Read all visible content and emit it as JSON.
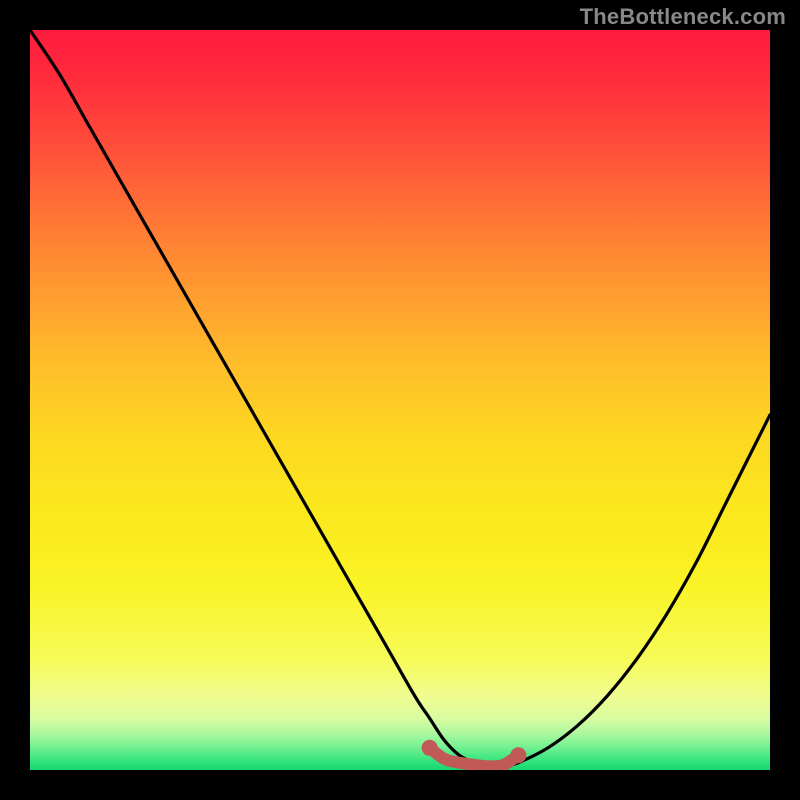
{
  "attribution": "TheBottleneck.com",
  "colors": {
    "background": "#000000",
    "curve": "#000000",
    "marker": "#c15a56",
    "gradient_top": "#ff1a3e",
    "gradient_bottom": "#17d56e"
  },
  "chart_data": {
    "type": "line",
    "title": "",
    "xlabel": "",
    "ylabel": "",
    "xlim": [
      0,
      100
    ],
    "ylim": [
      0,
      100
    ],
    "series": [
      {
        "name": "bottleneck-curve",
        "x": [
          0,
          4,
          8,
          12,
          16,
          20,
          24,
          28,
          32,
          36,
          40,
          44,
          48,
          52,
          54,
          56,
          58,
          60,
          62,
          64,
          66,
          70,
          74,
          78,
          82,
          86,
          90,
          94,
          98,
          100
        ],
        "y": [
          100,
          94,
          87,
          80,
          73,
          66,
          59,
          52,
          45,
          38,
          31,
          24,
          17,
          10,
          7,
          4,
          2,
          1,
          0.5,
          0.5,
          1,
          3,
          6,
          10,
          15,
          21,
          28,
          36,
          44,
          48
        ]
      },
      {
        "name": "highlight-band",
        "x": [
          54,
          56,
          58,
          60,
          62,
          64,
          66
        ],
        "y": [
          3,
          1.5,
          1,
          0.7,
          0.5,
          0.7,
          2
        ]
      }
    ],
    "markers": [
      {
        "name": "sweet-spot-start",
        "x": 54,
        "y": 3
      },
      {
        "name": "sweet-spot-end",
        "x": 66,
        "y": 2
      }
    ]
  }
}
